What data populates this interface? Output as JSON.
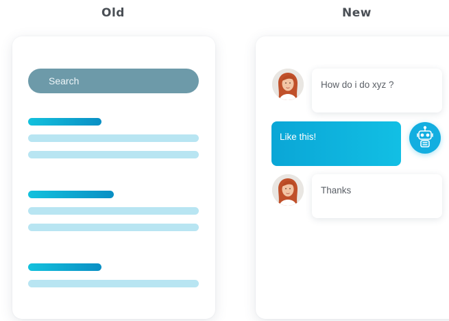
{
  "headings": {
    "old": "Old",
    "new": "New"
  },
  "old_panel": {
    "search_placeholder": "Search",
    "result_groups": 3
  },
  "new_panel": {
    "messages": [
      {
        "sender": "user",
        "text": "How do i do xyz ?"
      },
      {
        "sender": "bot",
        "text": "Like this!"
      },
      {
        "sender": "user",
        "text": "Thanks"
      }
    ]
  },
  "colors": {
    "heading": "#4a4f55",
    "search_bg": "#6d9aa9",
    "accent_start": "#13c1dd",
    "accent_end": "#0a8fc4",
    "line_light": "#b8e5f2",
    "bot_bubble": "#0aa6d6"
  },
  "icons": {
    "user_avatar": "woman-avatar-icon",
    "bot_avatar": "robot-icon"
  }
}
